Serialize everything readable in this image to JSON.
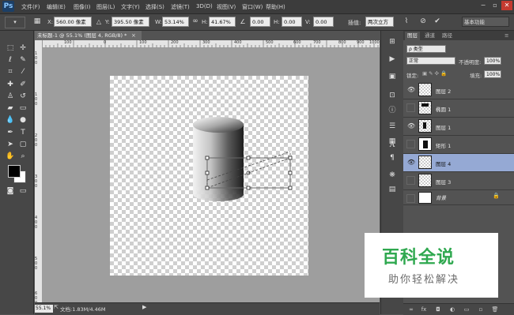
{
  "app": {
    "logo": "Ps",
    "workspace_select": "基本功能"
  },
  "menu": [
    "文件(F)",
    "编辑(E)",
    "图像(I)",
    "图层(L)",
    "文字(Y)",
    "选择(S)",
    "滤镜(T)",
    "3D(D)",
    "视图(V)",
    "窗口(W)",
    "帮助(H)"
  ],
  "window_controls": {
    "minimize": "−",
    "restore": "▫",
    "close": "✕"
  },
  "options_bar": {
    "x_label": "X:",
    "x_value": "560.00 像素",
    "y_label": "Y:",
    "y_value": "395.50 像素",
    "w_label": "W:",
    "w_value": "53.14%",
    "h_label": "H:",
    "h_value": "41.67%",
    "angle_value": "0.00",
    "hskew_label": "H:",
    "hskew_value": "0.00",
    "vskew_label": "V:",
    "vskew_value": "0.00",
    "interp_label": "插值:",
    "interp_value": "两次立方",
    "cancel_icon": "⊘",
    "commit_icon": "✔"
  },
  "document": {
    "tab_title": "未标题-1 @ 55.1% (图层 4, RGB/8) *",
    "close": "×",
    "ruler_top": [
      "100",
      "0",
      "100",
      "200",
      "300",
      "400",
      "500",
      "600",
      "700",
      "800",
      "900",
      "1000"
    ],
    "ruler_left": [
      "1",
      "0",
      "0",
      "1",
      "0",
      "0",
      "2",
      "0",
      "0",
      "3",
      "0",
      "0",
      "4",
      "0",
      "0",
      "5",
      "0",
      "0",
      "6",
      "0",
      "0"
    ]
  },
  "status": {
    "zoom": "55.1%",
    "doc_size": "文档:1.83M/4.46M",
    "arrow": "▶"
  },
  "layers_panel": {
    "tabs": [
      "图层",
      "通道",
      "路径"
    ],
    "filter": "ρ 类型",
    "blend_mode": "正常",
    "opacity_label": "不透明度:",
    "opacity": "100%",
    "lock_label": "锁定:",
    "fill_label": "填充:",
    "fill": "100%",
    "layers": [
      {
        "name": "图层 2",
        "visible": true
      },
      {
        "name": "椭圆 1",
        "visible": false
      },
      {
        "name": "图层 1",
        "visible": true
      },
      {
        "name": "矩形 1",
        "visible": false
      },
      {
        "name": "图层 4",
        "visible": true,
        "selected": true
      },
      {
        "name": "图层 3",
        "visible": false
      },
      {
        "name": "背景",
        "visible": false
      }
    ]
  },
  "watermark": {
    "title": "百科全说",
    "subtitle": "助你轻松解决"
  }
}
